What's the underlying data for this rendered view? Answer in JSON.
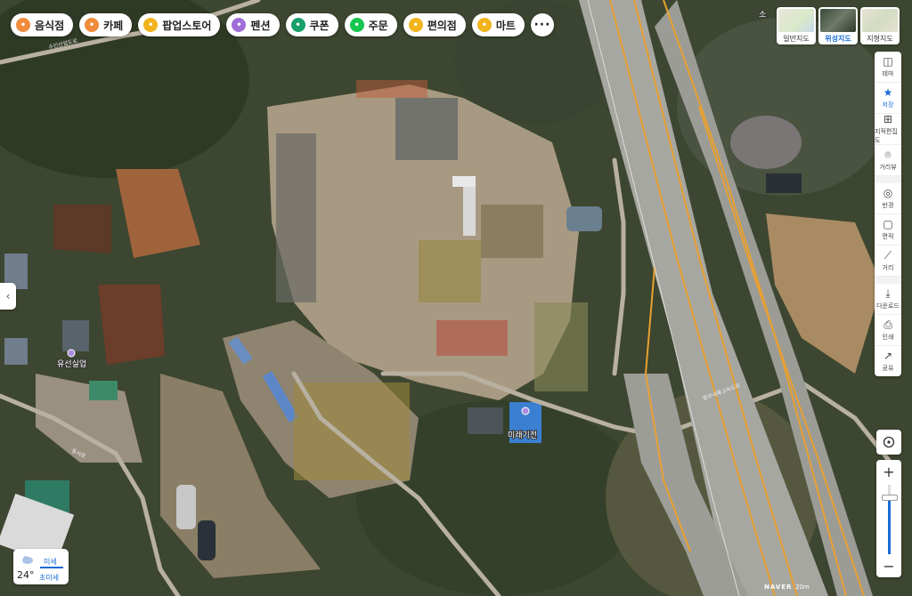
{
  "categories": [
    {
      "label": "음식점",
      "icon": "restaurant-icon",
      "color": "#f08c3c"
    },
    {
      "label": "카페",
      "icon": "cafe-icon",
      "color": "#f08c3c"
    },
    {
      "label": "팝업스토어",
      "icon": "popup-store-icon",
      "color": "#f2b41c"
    },
    {
      "label": "펜션",
      "icon": "pension-icon",
      "color": "#a06ed8"
    },
    {
      "label": "쿠폰",
      "icon": "coupon-icon",
      "color": "#17a06a"
    },
    {
      "label": "주문",
      "icon": "order-icon",
      "color": "#17c64e"
    },
    {
      "label": "편의점",
      "icon": "convenience-store-icon",
      "color": "#f2b41c"
    },
    {
      "label": "마트",
      "icon": "mart-icon",
      "color": "#f2b41c"
    },
    {
      "label": "···",
      "icon": "more-icon",
      "color": "#555555"
    }
  ],
  "map_types": [
    {
      "label": "일반지도",
      "selected": false
    },
    {
      "label": "위성지도",
      "selected": true
    },
    {
      "label": "지형지도",
      "selected": false
    }
  ],
  "toolbar": [
    {
      "label": "테마",
      "icon": "layers-icon",
      "active": false
    },
    {
      "label": "저장",
      "icon": "star-icon",
      "active": true
    },
    {
      "label": "지적편집도",
      "icon": "cadastral-icon",
      "active": false
    },
    {
      "label": "거리뷰",
      "icon": "streetview-icon",
      "active": false
    },
    {
      "label": "반경",
      "icon": "radius-icon",
      "active": false
    },
    {
      "label": "면적",
      "icon": "area-icon",
      "active": false
    },
    {
      "label": "거리",
      "icon": "ruler-icon",
      "active": false
    },
    {
      "label": "다운로드",
      "icon": "download-icon",
      "active": false
    },
    {
      "label": "인쇄",
      "icon": "print-icon",
      "active": false
    },
    {
      "label": "공유",
      "icon": "share-icon",
      "active": false
    }
  ],
  "zoom": {
    "plus": "+",
    "minus": "−",
    "level_fraction": 0.82
  },
  "weather": {
    "temperature": "24°",
    "line1": "미세",
    "line2": "초미세"
  },
  "places": [
    {
      "name": "유선실업"
    },
    {
      "name": "미래기전"
    },
    {
      "name": "소"
    }
  ],
  "road_labels": [
    "수인산업도로",
    "중부내륙고속도로",
    "동서로"
  ],
  "map_footer": {
    "brand": "NAVER",
    "scale": "20m"
  },
  "colors": {
    "accent": "#1a6bd6",
    "highway_line": "#e8a030"
  }
}
